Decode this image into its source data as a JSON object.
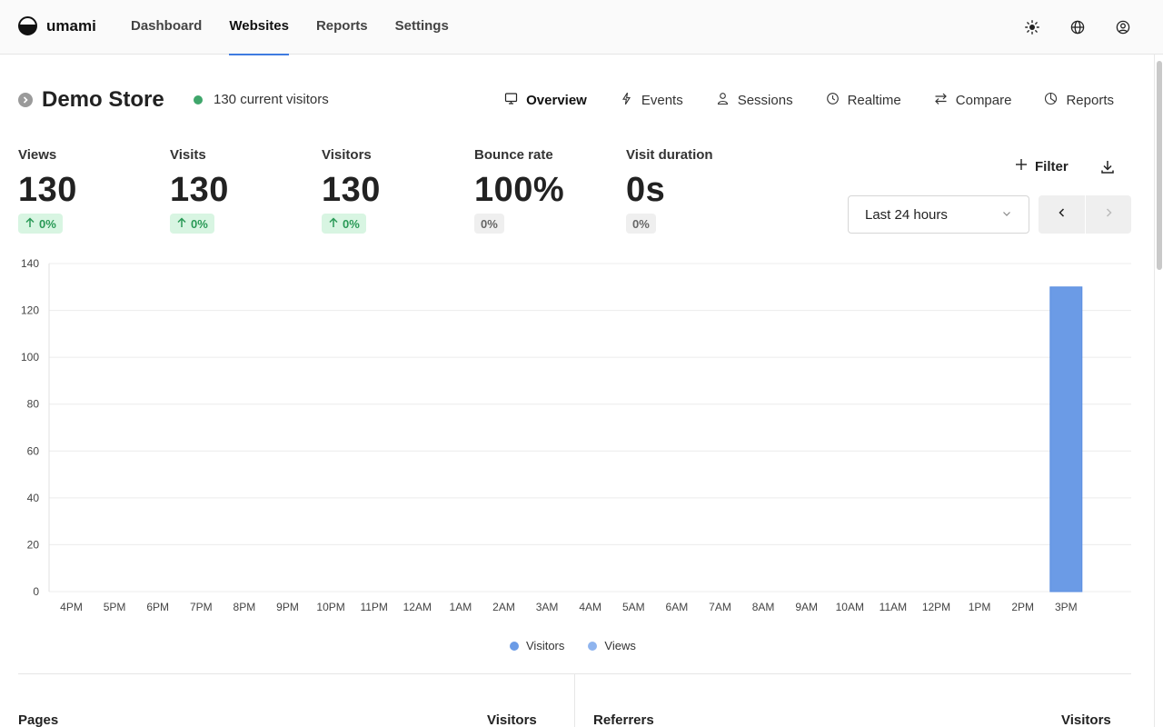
{
  "app": {
    "name": "umami"
  },
  "nav": [
    {
      "label": "Dashboard",
      "active": false
    },
    {
      "label": "Websites",
      "active": true
    },
    {
      "label": "Reports",
      "active": false
    },
    {
      "label": "Settings",
      "active": false
    }
  ],
  "top_icons": [
    "theme-sun-icon",
    "language-globe-icon",
    "profile-icon"
  ],
  "site": {
    "title": "Demo Store",
    "live_text": "130 current visitors",
    "live_color": "#3fa66b"
  },
  "tabs": [
    {
      "label": "Overview",
      "icon": "monitor-icon",
      "active": true
    },
    {
      "label": "Events",
      "icon": "lightning-icon",
      "active": false
    },
    {
      "label": "Sessions",
      "icon": "user-icon",
      "active": false
    },
    {
      "label": "Realtime",
      "icon": "clock-icon",
      "active": false
    },
    {
      "label": "Compare",
      "icon": "arrows-swap-icon",
      "active": false
    },
    {
      "label": "Reports",
      "icon": "pie-icon",
      "active": false
    }
  ],
  "metrics": [
    {
      "label": "Views",
      "value": "130",
      "change": "0%",
      "trend": "up"
    },
    {
      "label": "Visits",
      "value": "130",
      "change": "0%",
      "trend": "up"
    },
    {
      "label": "Visitors",
      "value": "130",
      "change": "0%",
      "trend": "up"
    },
    {
      "label": "Bounce rate",
      "value": "100%",
      "change": "0%",
      "trend": "flat"
    },
    {
      "label": "Visit duration",
      "value": "0s",
      "change": "0%",
      "trend": "flat"
    }
  ],
  "filter": {
    "label": "Filter"
  },
  "date_range": {
    "selected": "Last 24 hours"
  },
  "chart_data": {
    "type": "bar",
    "categories": [
      "4PM",
      "5PM",
      "6PM",
      "7PM",
      "8PM",
      "9PM",
      "10PM",
      "11PM",
      "12AM",
      "1AM",
      "2AM",
      "3AM",
      "4AM",
      "5AM",
      "6AM",
      "7AM",
      "8AM",
      "9AM",
      "10AM",
      "11AM",
      "12PM",
      "1PM",
      "2PM",
      "3PM"
    ],
    "series": [
      {
        "name": "Visitors",
        "color": "#6b9be6",
        "values": [
          0,
          0,
          0,
          0,
          0,
          0,
          0,
          0,
          0,
          0,
          0,
          0,
          0,
          0,
          0,
          0,
          0,
          0,
          0,
          0,
          0,
          0,
          0,
          130
        ]
      },
      {
        "name": "Views",
        "color": "#8fb4ee",
        "values": [
          0,
          0,
          0,
          0,
          0,
          0,
          0,
          0,
          0,
          0,
          0,
          0,
          0,
          0,
          0,
          0,
          0,
          0,
          0,
          0,
          0,
          0,
          0,
          130
        ]
      }
    ],
    "yticks": [
      0,
      20,
      40,
      60,
      80,
      100,
      120,
      140
    ],
    "ylim": [
      0,
      140
    ],
    "grid": true,
    "legend_position": "bottom-center"
  },
  "panels": {
    "pages": {
      "title": "Pages",
      "metric": "Visitors"
    },
    "referrers": {
      "title": "Referrers",
      "metric": "Visitors"
    }
  }
}
